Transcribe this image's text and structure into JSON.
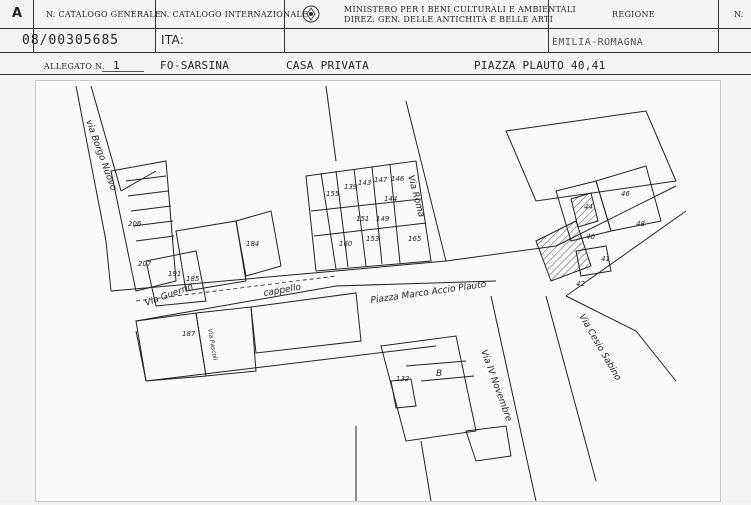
{
  "header": {
    "letter": "A",
    "cat_generale_label": "N. CATALOGO GENERALE",
    "cat_internazionale_label": "N. CATALOGO INTERNAZIONALE",
    "ministry_line1": "MINISTERO PER I BENI CULTURALI E AMBIENTALI",
    "ministry_line2": "DIREZ. GEN. DELLE ANTICHITÀ E BELLE ARTI",
    "regione_label": "REGIONE",
    "n_label": "N.",
    "catalog_number": "08/00305685",
    "ita_label": "ITA:",
    "regione_value": "EMILIA-ROMAGNA"
  },
  "allegato": {
    "label": "ALLEGATO N.",
    "number": "1",
    "location": "FO-SARSINA",
    "building": "CASA PRIVATA",
    "address": "PIAZZA PLAUTO 40,41"
  },
  "map": {
    "streets": {
      "borgo_nuovo": "via Borgo Nuovo",
      "via_roma": "Via Roma",
      "via_cappello": "cappello",
      "via_guerrin": "Via Guerrin",
      "piazza": "Piazza Marco Accio Plauto",
      "via_cesio_sabino": "Via Cesio Sabino",
      "via_novembre": "Via IV Novembre",
      "via_pascoli": "Via Pascoli"
    },
    "parcels": [
      "184",
      "191",
      "185",
      "206",
      "207",
      "187",
      "160",
      "165",
      "132",
      "B",
      "46",
      "48",
      "41",
      "40",
      "44",
      "42",
      "146",
      "144",
      "149",
      "151",
      "153",
      "155",
      "139",
      "143",
      "147"
    ]
  }
}
